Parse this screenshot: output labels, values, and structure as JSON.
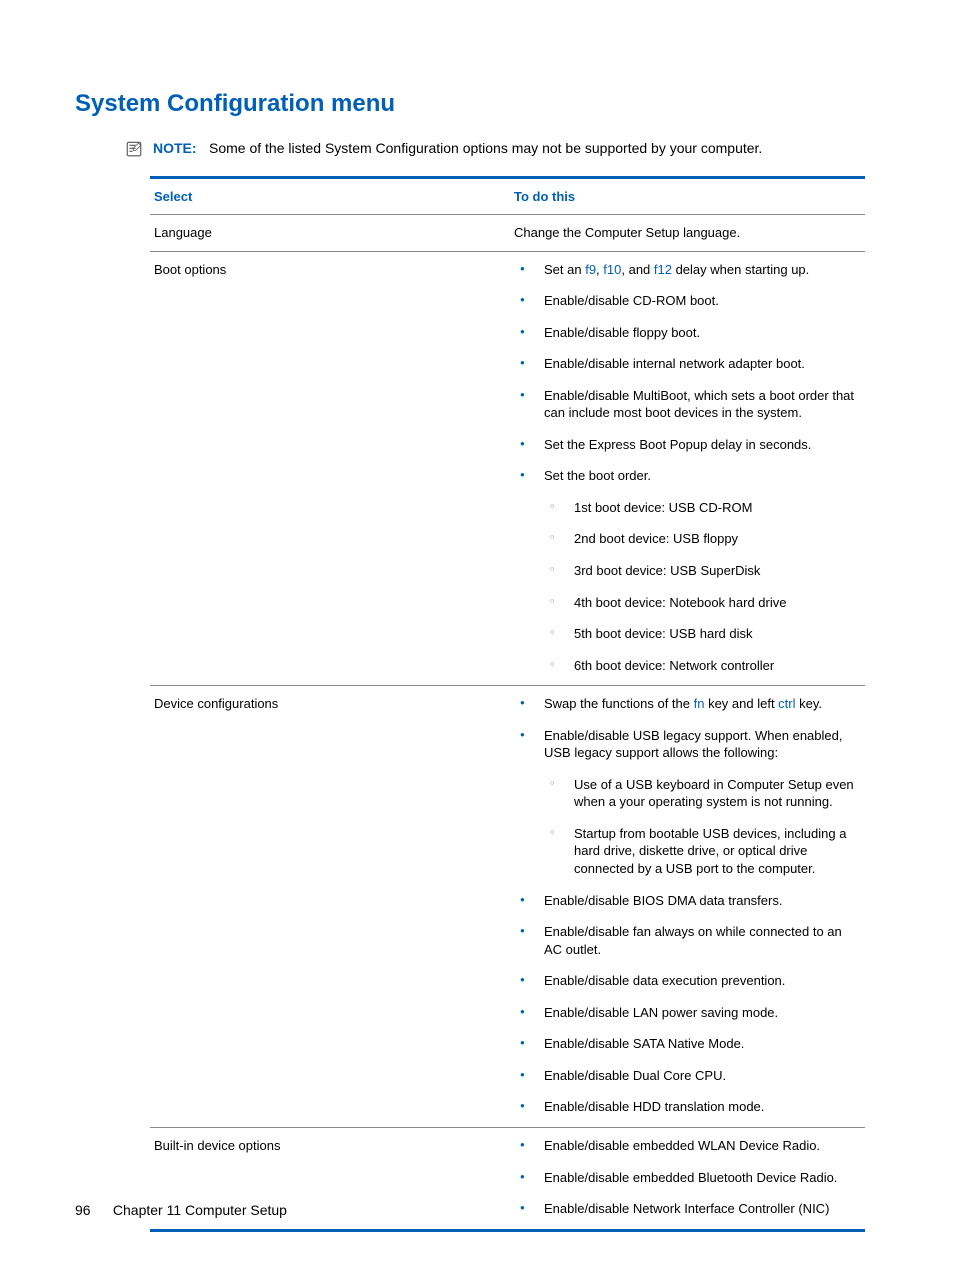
{
  "title": "System Configuration menu",
  "note": {
    "label": "NOTE:",
    "text": "Some of the listed System Configuration options may not be supported by your computer."
  },
  "table": {
    "head_select": "Select",
    "head_todo": "To do this",
    "rows": {
      "language": {
        "select": "Language",
        "todo": "Change the Computer Setup language."
      },
      "boot": {
        "select": "Boot options",
        "b1_prefix": "Set an ",
        "b1_f9": "f9",
        "b1_sep1": ", ",
        "b1_f10": "f10",
        "b1_sep2": ", and ",
        "b1_f12": "f12",
        "b1_suffix": " delay when starting up.",
        "b2": "Enable/disable CD-ROM boot.",
        "b3": "Enable/disable floppy boot.",
        "b4": "Enable/disable internal network adapter boot.",
        "b5": "Enable/disable MultiBoot, which sets a boot order that can include most boot devices in the system.",
        "b6": "Set the Express Boot Popup delay in seconds.",
        "b7": "Set the boot order.",
        "b7_s1": "1st boot device: USB CD-ROM",
        "b7_s2": "2nd boot device: USB floppy",
        "b7_s3": "3rd boot device: USB SuperDisk",
        "b7_s4": "4th boot device: Notebook hard drive",
        "b7_s5": "5th boot device: USB hard disk",
        "b7_s6": "6th boot device: Network controller"
      },
      "device": {
        "select": "Device configurations",
        "d1_prefix": "Swap the functions of the ",
        "d1_fn": "fn",
        "d1_mid": " key and left ",
        "d1_ctrl": "ctrl",
        "d1_suffix": " key.",
        "d2": "Enable/disable USB legacy support. When enabled, USB legacy support allows the following:",
        "d2_s1": "Use of a USB keyboard in Computer Setup even when a your operating system is not running.",
        "d2_s2": "Startup from bootable USB devices, including a hard drive, diskette drive, or optical drive connected by a USB port to the computer.",
        "d3": "Enable/disable BIOS DMA data transfers.",
        "d4": "Enable/disable fan always on while connected to an AC outlet.",
        "d5": "Enable/disable data execution prevention.",
        "d6": "Enable/disable LAN power saving mode.",
        "d7": "Enable/disable SATA Native Mode.",
        "d8": "Enable/disable Dual Core CPU.",
        "d9": "Enable/disable HDD translation mode."
      },
      "builtin": {
        "select": "Built-in device options",
        "e1": "Enable/disable embedded WLAN Device Radio.",
        "e2": "Enable/disable embedded Bluetooth Device Radio.",
        "e3": "Enable/disable Network Interface Controller (NIC)"
      }
    }
  },
  "footer": {
    "page": "96",
    "chapter": "Chapter 11   Computer Setup"
  }
}
